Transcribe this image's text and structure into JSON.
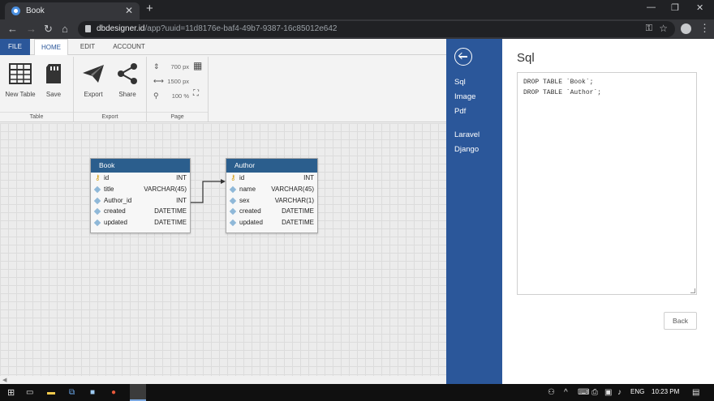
{
  "browser": {
    "tab_title": "Book",
    "url_host": "dbdesigner.id",
    "url_path": "/app?uuid=11d8176e-baf4-49b7-9387-16c85012e642"
  },
  "menu": {
    "file": "FILE",
    "home": "HOME",
    "edit": "EDIT",
    "account": "ACCOUNT"
  },
  "ribbon": {
    "table_group": "Table",
    "export_group": "Export",
    "page_group": "Page",
    "new_table": "New Table",
    "save": "Save",
    "export": "Export",
    "share": "Share",
    "page_width": "700 px",
    "page_height": "1500 px",
    "zoom": "100 %"
  },
  "tables": [
    {
      "name": "Book",
      "columns": [
        {
          "name": "id",
          "type": "INT",
          "key": true
        },
        {
          "name": "title",
          "type": "VARCHAR(45)",
          "key": false
        },
        {
          "name": "Author_id",
          "type": "INT",
          "key": false
        },
        {
          "name": "created",
          "type": "DATETIME",
          "key": false
        },
        {
          "name": "updated",
          "type": "DATETIME",
          "key": false
        }
      ]
    },
    {
      "name": "Author",
      "columns": [
        {
          "name": "id",
          "type": "INT",
          "key": true
        },
        {
          "name": "name",
          "type": "VARCHAR(45)",
          "key": false
        },
        {
          "name": "sex",
          "type": "VARCHAR(1)",
          "key": false
        },
        {
          "name": "created",
          "type": "DATETIME",
          "key": false
        },
        {
          "name": "updated",
          "type": "DATETIME",
          "key": false
        }
      ]
    }
  ],
  "side_nav": [
    "Sql",
    "Image",
    "Pdf",
    "Laravel",
    "Django"
  ],
  "sql_panel": {
    "title": "Sql",
    "content": "DROP TABLE `Book`;\nDROP TABLE `Author`;",
    "back_label": "Back"
  },
  "taskbar": {
    "lang": "ENG",
    "time": "10:23 PM"
  },
  "colors": {
    "accent": "#2b579a",
    "table_header": "#2b5e8d"
  }
}
